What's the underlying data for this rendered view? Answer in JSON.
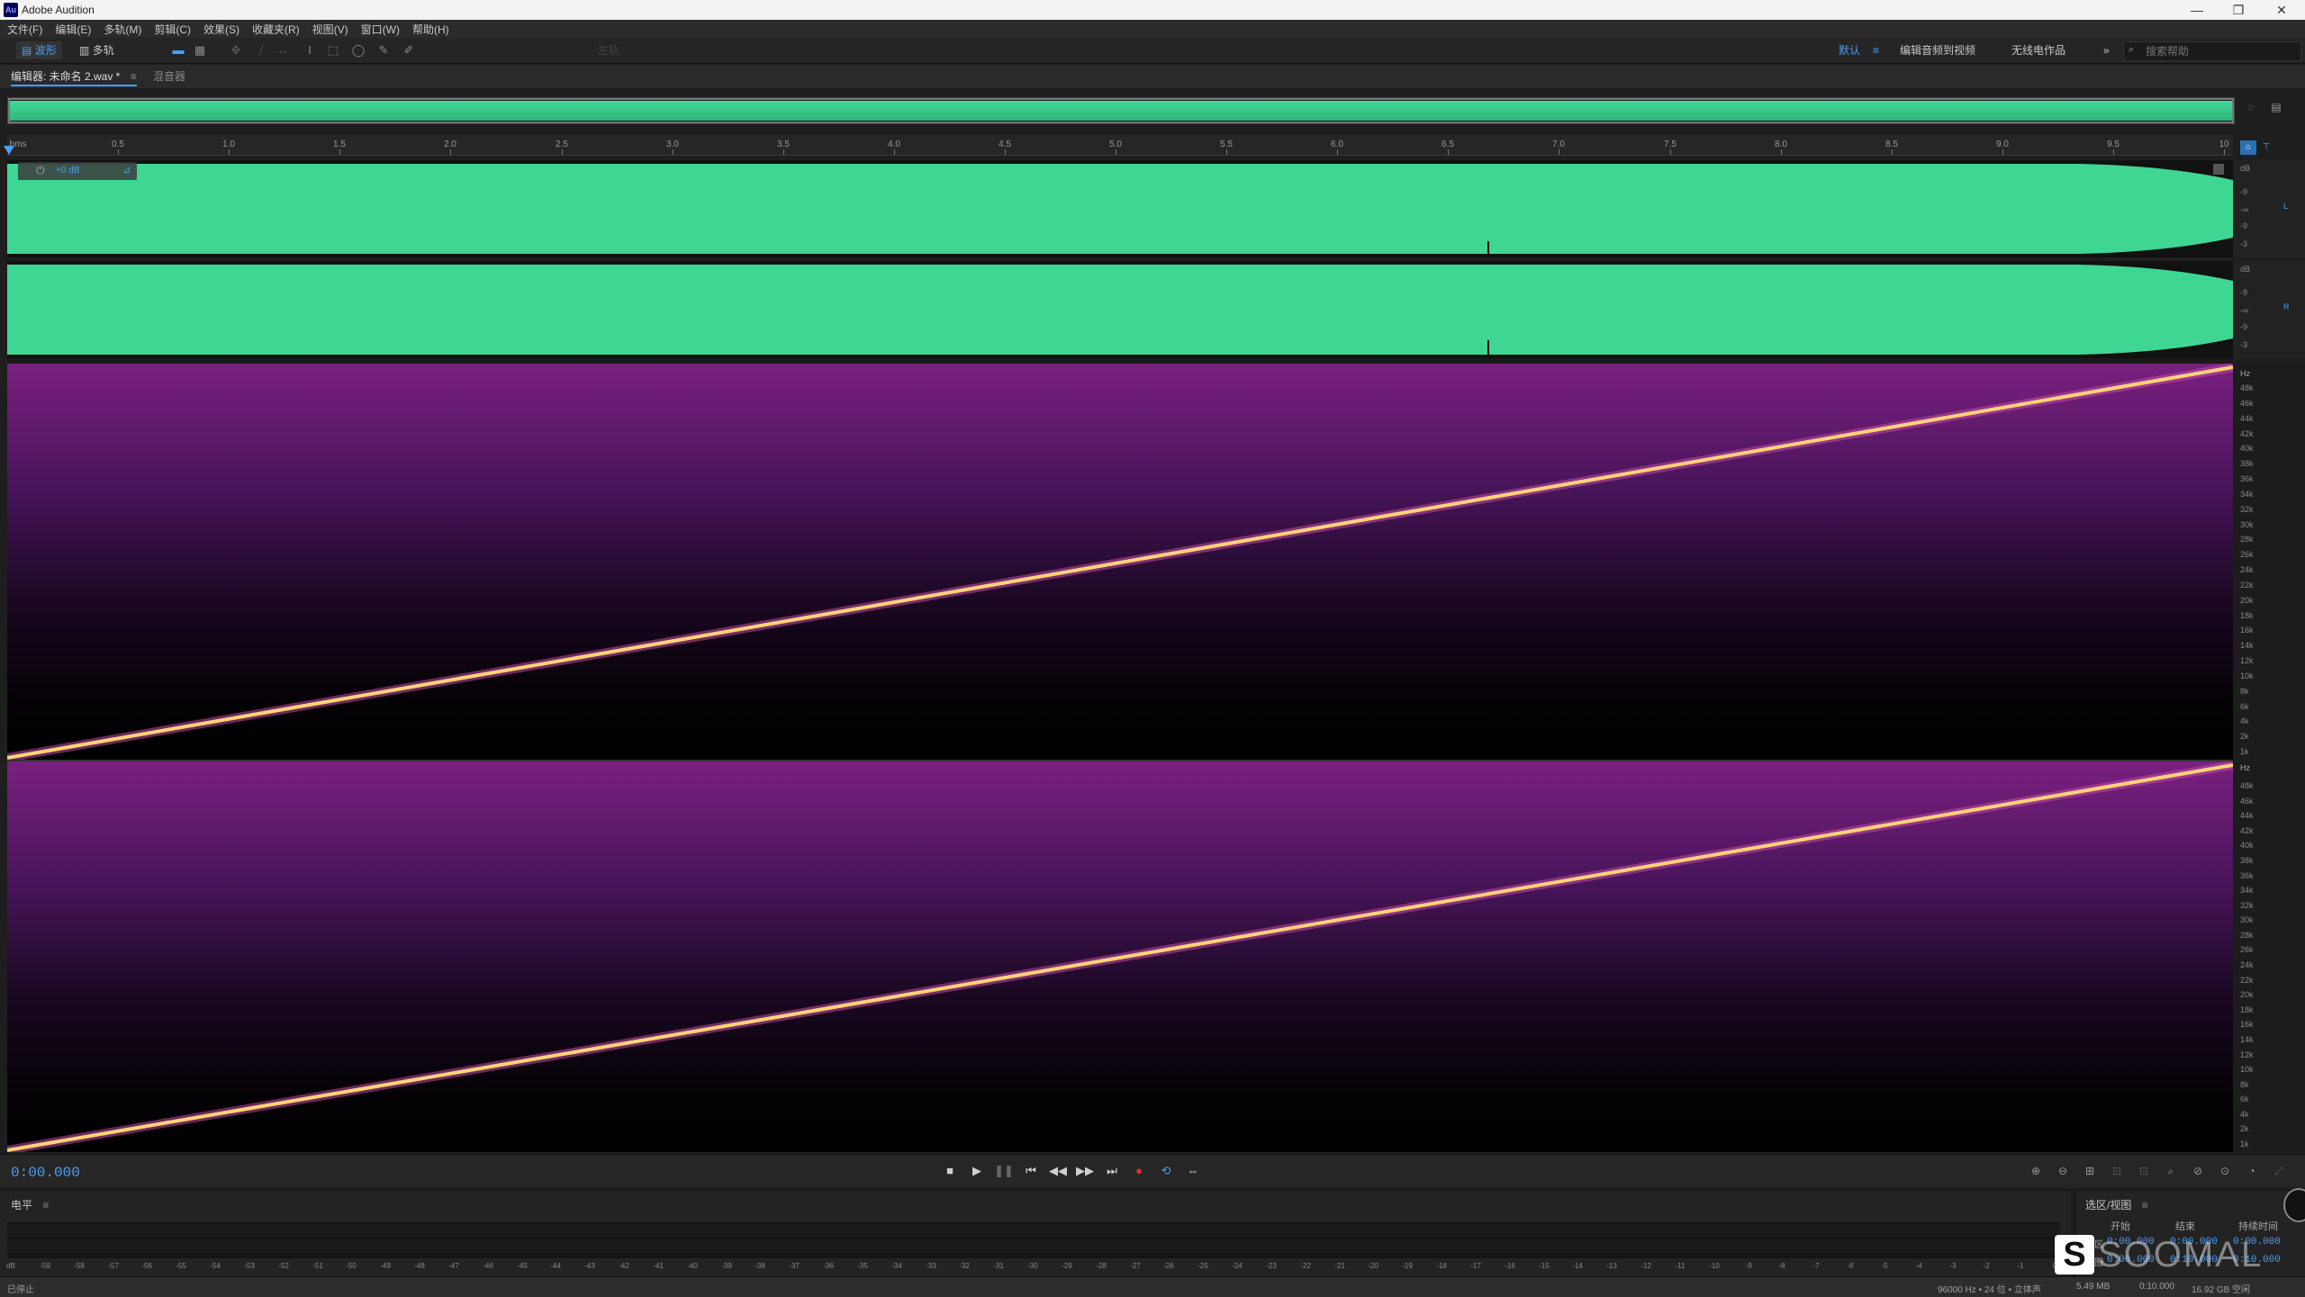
{
  "app": {
    "title": "Adobe Audition",
    "icon_text": "Au",
    "icon": "audition-app-icon"
  },
  "window_controls": [
    "—",
    "❐",
    "✕"
  ],
  "menu": [
    "文件(F)",
    "编辑(E)",
    "多轨(M)",
    "剪辑(C)",
    "效果(S)",
    "收藏夹(R)",
    "视图(V)",
    "窗口(W)",
    "帮助(H)"
  ],
  "toolbar": {
    "waveform_label": "波形",
    "multitrack_label": "多轨",
    "disabled_label": "左轨",
    "workspaces": {
      "default": "默认",
      "edit_audio_to_video": "编辑音频到视频",
      "radio_works": "无线电作品"
    },
    "more": "»",
    "search_placeholder": "搜索帮助"
  },
  "editor": {
    "tab_label": "编辑器: 未命名 2.wav *",
    "mixer_label": "混音器",
    "menu_icon": "≡"
  },
  "ruler": {
    "unit": "hms",
    "ticks": [
      "0.5",
      "1.0",
      "1.5",
      "2.0",
      "2.5",
      "3.0",
      "3.5",
      "4.0",
      "4.5",
      "5.0",
      "5.5",
      "6.0",
      "6.5",
      "7.0",
      "7.5",
      "8.0",
      "8.5",
      "9.0",
      "9.5",
      "10"
    ]
  },
  "hud": {
    "gain": "+0 dB"
  },
  "amp_scale": {
    "unit": "dB",
    "labels": [
      "-9",
      "-∞",
      "-9",
      "-3"
    ]
  },
  "channels": {
    "left": "L",
    "right": "R"
  },
  "freq_scale": {
    "unit": "Hz",
    "top_labels": [
      "48k",
      "46k",
      "44k",
      "42k",
      "40k",
      "38k",
      "36k",
      "34k",
      "32k",
      "30k",
      "28k",
      "26k",
      "24k",
      "22k",
      "20k",
      "18k",
      "16k",
      "14k",
      "12k",
      "10k",
      "8k",
      "6k",
      "4k",
      "2k",
      "1k"
    ],
    "bottom_labels": [
      "48k",
      "46k",
      "44k",
      "42k",
      "40k",
      "38k",
      "36k",
      "34k",
      "32k",
      "30k",
      "28k",
      "26k",
      "24k",
      "22k",
      "20k",
      "18k",
      "16k",
      "14k",
      "12k",
      "10k",
      "8k",
      "6k",
      "4k",
      "2k",
      "1k"
    ]
  },
  "transport": {
    "time": "0:00.000"
  },
  "levels": {
    "title": "电平",
    "menu_icon": "≡",
    "scale": [
      "dB",
      "-59",
      "-58",
      "-57",
      "-56",
      "-55",
      "-54",
      "-53",
      "-52",
      "-51",
      "-50",
      "-49",
      "-48",
      "-47",
      "-46",
      "-45",
      "-44",
      "-43",
      "-42",
      "-41",
      "-40",
      "-39",
      "-38",
      "-37",
      "-36",
      "-35",
      "-34",
      "-33",
      "-32",
      "-31",
      "-30",
      "-29",
      "-28",
      "-27",
      "-26",
      "-25",
      "-24",
      "-23",
      "-22",
      "-21",
      "-20",
      "-19",
      "-18",
      "-17",
      "-16",
      "-15",
      "-14",
      "-13",
      "-12",
      "-11",
      "-10",
      "-9",
      "-8",
      "-7",
      "-6",
      "-5",
      "-4",
      "-3",
      "-2",
      "-1",
      "0"
    ]
  },
  "selection_view": {
    "title": "选区/视图",
    "menu_icon": "≡",
    "headers": {
      "start": "开始",
      "end": "结束",
      "duration": "持续时间"
    },
    "rows": [
      {
        "label": "选区",
        "start": "0:00.000",
        "end": "0:00.000",
        "duration": "0:00.000"
      },
      {
        "label": "视图",
        "start": "0:00.000",
        "end": "0:10.000",
        "duration": "0:10.000"
      }
    ]
  },
  "status": {
    "state": "已停止",
    "format": "96000 Hz • 24 位 • 立体声",
    "size": "5.49 MB",
    "duration": "0:10.000",
    "free": "16.92 GB 空闲"
  },
  "watermark": "SOOMAL",
  "colors": {
    "accent": "#4a9ff5",
    "waveform": "#3fd694",
    "spectral_line": "#ffd37a",
    "spectral_bg": "#5a1a6a"
  }
}
